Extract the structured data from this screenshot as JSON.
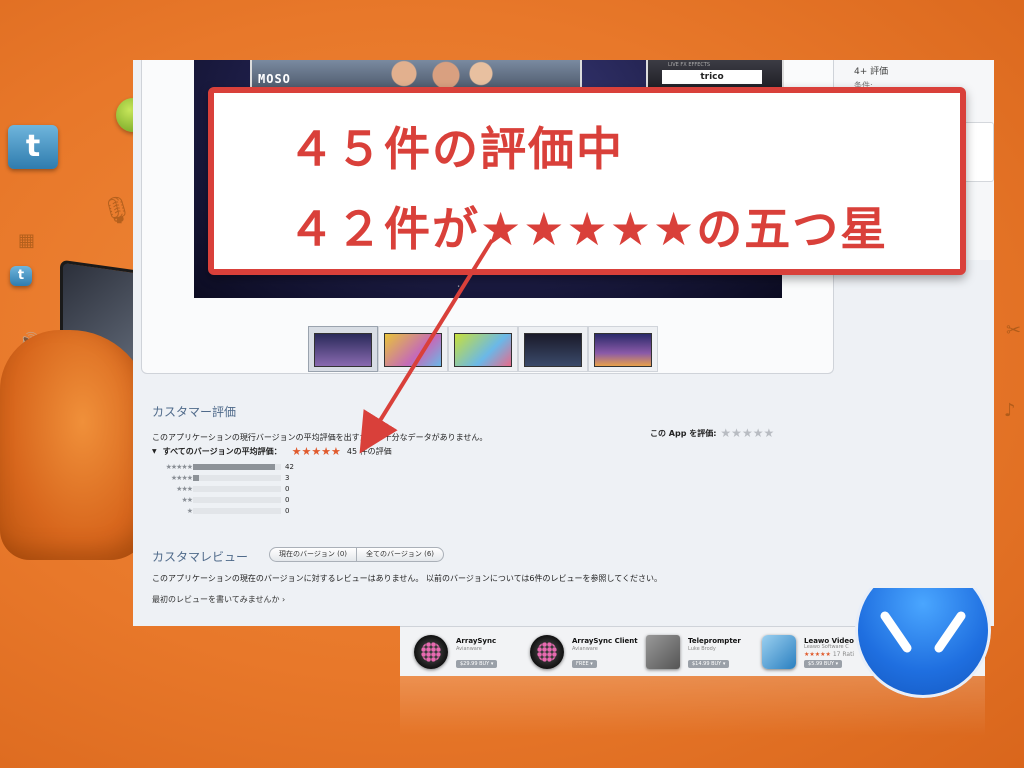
{
  "callout": {
    "line1": "４５件の評価中",
    "line2": "４２件が★★★★★の五つ星"
  },
  "sidebar": {
    "age_rating": "4+ 評価",
    "requirements": "条件:"
  },
  "screenshot": {
    "video_logo": "MOSO",
    "fx_label": "LIVE FX EFFECTS",
    "fx_name": "trico"
  },
  "ratings": {
    "section_title": "カスタマー評価",
    "current_msg": "このアプリケーションの現行バージョンの平均評価を出すための十分なデータがありません。",
    "rate_app_label": "この App を評価:",
    "all_versions_label": "すべてのバージョンの平均評価：",
    "average_stars": "★★★★★",
    "rate_stars": "★★★★★",
    "count_text": "45 件の評価",
    "breakdown": [
      {
        "stars": "★★★★★",
        "count": "42",
        "fraction": 0.93
      },
      {
        "stars": "★★★★",
        "count": "3",
        "fraction": 0.07
      },
      {
        "stars": "★★★",
        "count": "0",
        "fraction": 0
      },
      {
        "stars": "★★",
        "count": "0",
        "fraction": 0
      },
      {
        "stars": "★",
        "count": "0",
        "fraction": 0
      }
    ]
  },
  "reviews": {
    "section_title": "カスタマレビュー",
    "tab_current": "現在のバージョン (0)",
    "tab_all": "全てのバージョン (6)",
    "message": "このアプリケーションの現在のバージョンに対するレビューはありません。 以前のバージョンについては6件のレビューを参照してください。",
    "write_link": "最初のレビューを書いてみませんか ›"
  },
  "related_apps": [
    {
      "name": "ArraySync",
      "developer": "Avianware",
      "price": "$29.99 BUY ▾"
    },
    {
      "name": "ArraySync Client",
      "developer": "Avianware",
      "price": "FREE ▾"
    },
    {
      "name": "Teleprompter",
      "developer": "Luke Brody",
      "price": "$14.99 BUY ▾"
    },
    {
      "name": "Leawo Video C",
      "developer": "Leawo Software C",
      "stars": "★★★★★",
      "ratings_count": "17 Rati",
      "price": "$5.99 BUY ▾"
    }
  ],
  "colors": {
    "background": "#e8782a",
    "callout_red": "#d9403a",
    "section_title_blue": "#4f6a8a",
    "star_orange": "#e05a2c"
  }
}
